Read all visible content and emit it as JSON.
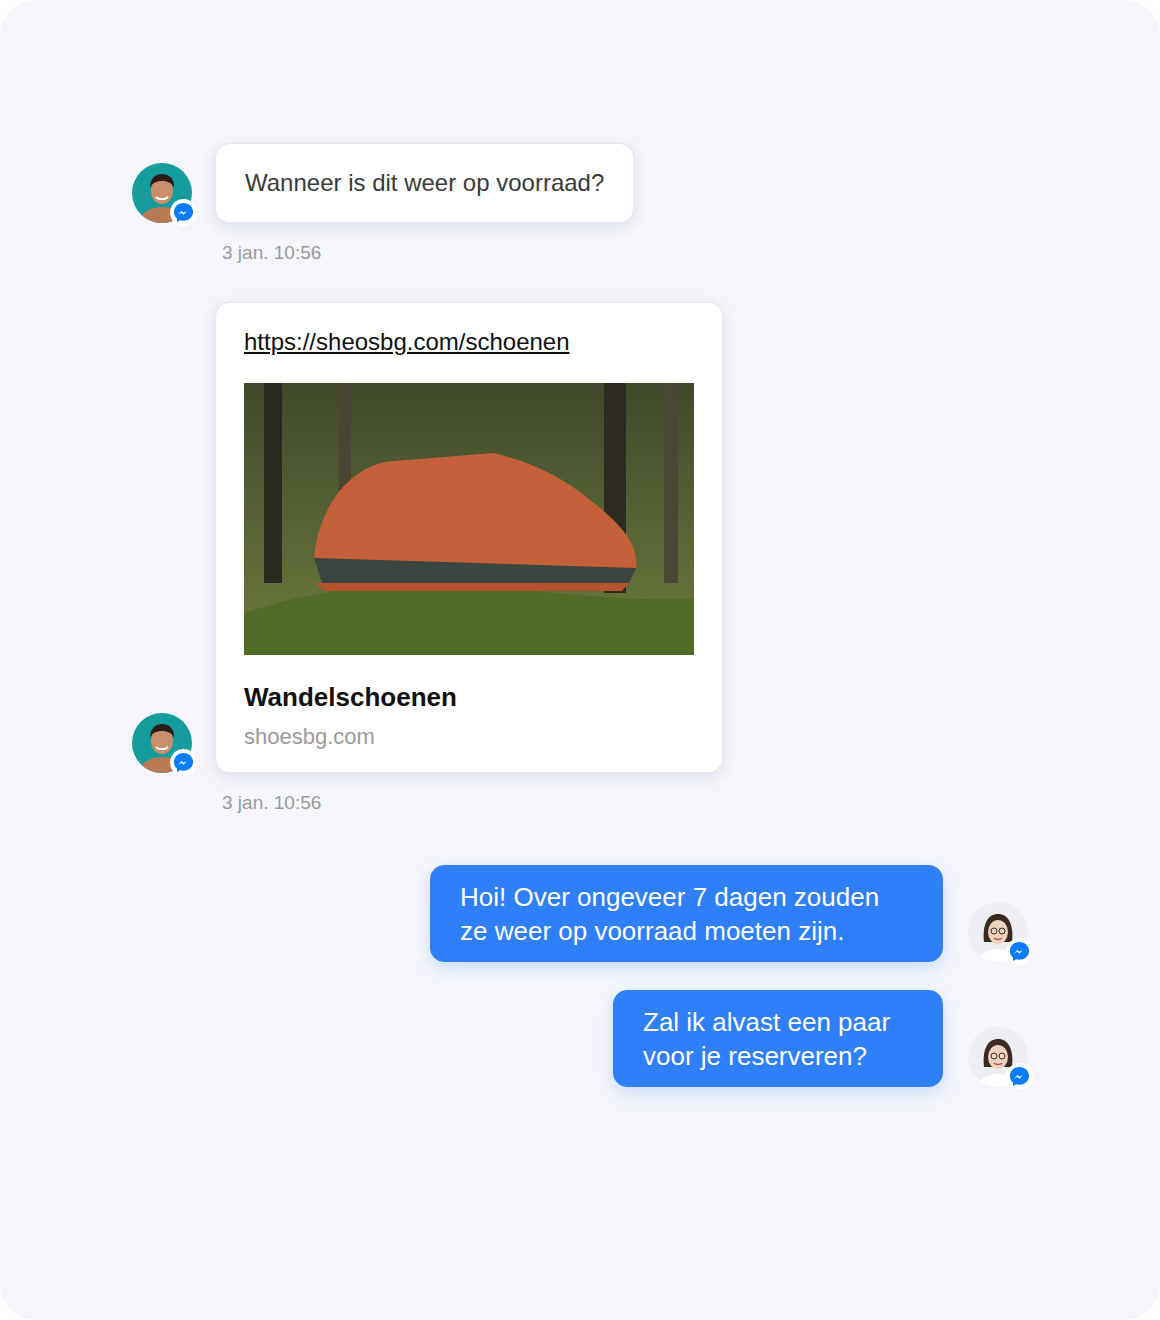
{
  "conversation": {
    "messages": [
      {
        "sender": "customer",
        "kind": "text",
        "text": "Wanneer is dit weer op voorraad?",
        "time": "3 jan. 10:56"
      },
      {
        "sender": "customer",
        "kind": "link",
        "url": "https://sheosbg.com/schoenen",
        "title": "Wandelschoenen",
        "domain": "shoesbg.com",
        "time": "3 jan. 10:56"
      },
      {
        "sender": "agent",
        "kind": "text",
        "text": "Hoi! Over ongeveer 7 dagen zouden ze weer op voorraad moeten zijn."
      },
      {
        "sender": "agent",
        "kind": "text",
        "text": "Zal ik alvast een paar voor je reserveren?"
      }
    ]
  }
}
